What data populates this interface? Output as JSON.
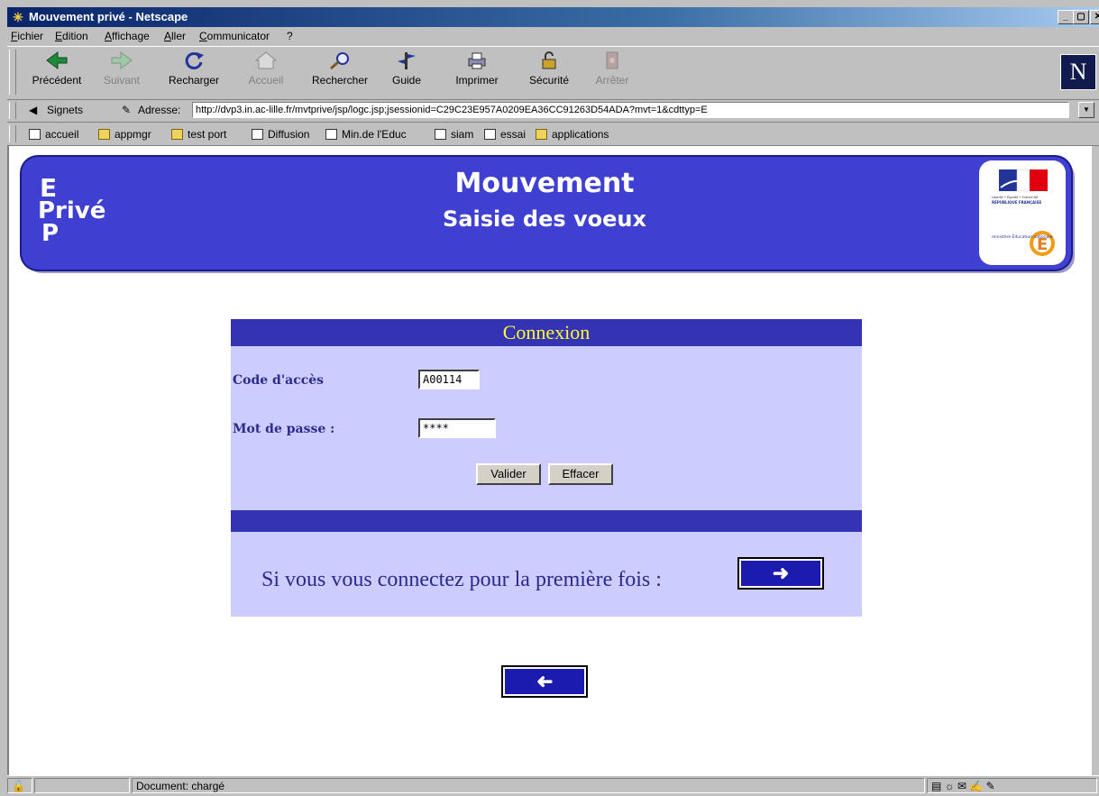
{
  "window": {
    "title": "Mouvement privé - Netscape",
    "controls": [
      "_",
      "▢",
      "✕"
    ]
  },
  "menu": [
    "Fichier",
    "Edition",
    "Affichage",
    "Aller",
    "Communicator",
    "?"
  ],
  "toolbar": {
    "buttons": [
      {
        "label": "Précédent",
        "icon": "back-arrow-icon",
        "enabled": true
      },
      {
        "label": "Suivant",
        "icon": "forward-arrow-icon",
        "enabled": false
      },
      {
        "label": "Recharger",
        "icon": "reload-icon",
        "enabled": true
      },
      {
        "label": "Accueil",
        "icon": "home-icon",
        "enabled": false
      },
      {
        "label": "Rechercher",
        "icon": "search-icon",
        "enabled": true
      },
      {
        "label": "Guide",
        "icon": "guide-icon",
        "enabled": true
      },
      {
        "label": "Imprimer",
        "icon": "printer-icon",
        "enabled": true
      },
      {
        "label": "Sécurité",
        "icon": "lock-icon",
        "enabled": true
      },
      {
        "label": "Arrêter",
        "icon": "stop-icon",
        "enabled": false
      }
    ],
    "logo": "N"
  },
  "location": {
    "bookmarks_label": "Signets",
    "address_label": "Adresse:",
    "url": "http://dvp3.in.ac-lille.fr/mvtprive/jsp/logc.jsp;jsessionid=C29C23E957A0209EA36CC91263D54ADA?mvt=1&cdttyp=E"
  },
  "bookmarks": [
    {
      "label": "accueil",
      "icon": "page"
    },
    {
      "label": "appmgr",
      "icon": "folder"
    },
    {
      "label": "test port",
      "icon": "folder"
    },
    {
      "label": "Diffusion",
      "icon": "page"
    },
    {
      "label": "Min.de l'Educ",
      "icon": "page"
    },
    {
      "label": "siam",
      "icon": "page"
    },
    {
      "label": "essai",
      "icon": "page"
    },
    {
      "label": "applications",
      "icon": "folder"
    }
  ],
  "banner": {
    "letter_e": "E",
    "prive": "Privé",
    "letter_p": "P",
    "title": "Mouvement",
    "subtitle": "Saisie des voeux",
    "logo_text_1": "Liberté • Égalité • Fraternité",
    "logo_text_2": "RÉPUBLIQUE FRANÇAISE",
    "logo_text_3": "ministère Éducation nationale",
    "logo_letter": "E"
  },
  "form": {
    "header": "Connexion",
    "code_label": "Code d'accès",
    "code_value": "A00114",
    "password_label": "Mot de passe :",
    "password_value": "****",
    "validate_label": "Valider",
    "clear_label": "Effacer",
    "first_time_text": "Si vous vous connectez pour la première fois :"
  },
  "status": {
    "text": "Document: chargé"
  }
}
